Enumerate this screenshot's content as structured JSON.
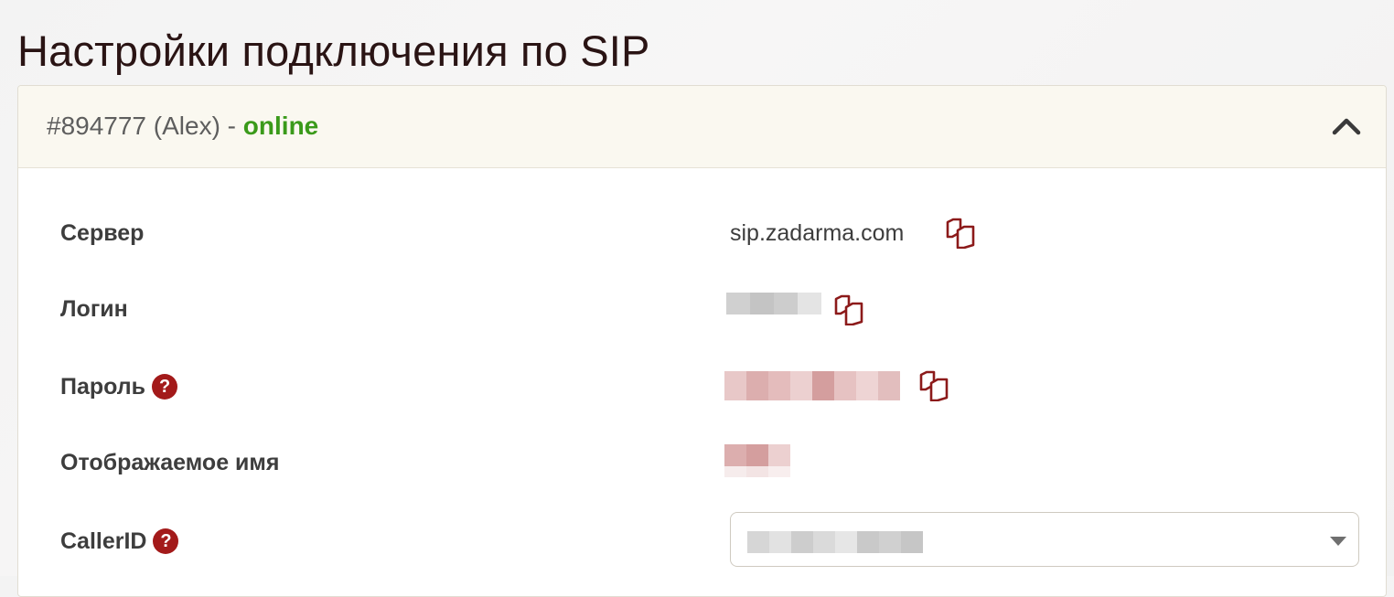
{
  "page": {
    "title": "Настройки подключения по SIP"
  },
  "account": {
    "number_label": "#894777 (Alex) - ",
    "status": "online",
    "status_color": "#3a9a1a",
    "expanded": true
  },
  "fields": {
    "server": {
      "label": "Сервер",
      "value": "sip.zadarma.com",
      "copy_icon": "copy-icon"
    },
    "login": {
      "label": "Логин",
      "value_masked": true,
      "copy_icon": "copy-icon"
    },
    "password": {
      "label": "Пароль",
      "help_icon": "?",
      "value_masked": true,
      "copy_icon": "copy-icon"
    },
    "display_name": {
      "label": "Отображаемое имя",
      "value_masked": true
    },
    "callerid": {
      "label": "CallerID",
      "help_icon": "?",
      "select_value_masked": true
    }
  },
  "colors": {
    "accent": "#a31a1a",
    "title": "#2a1414",
    "header_bg": "#faf8f0"
  }
}
